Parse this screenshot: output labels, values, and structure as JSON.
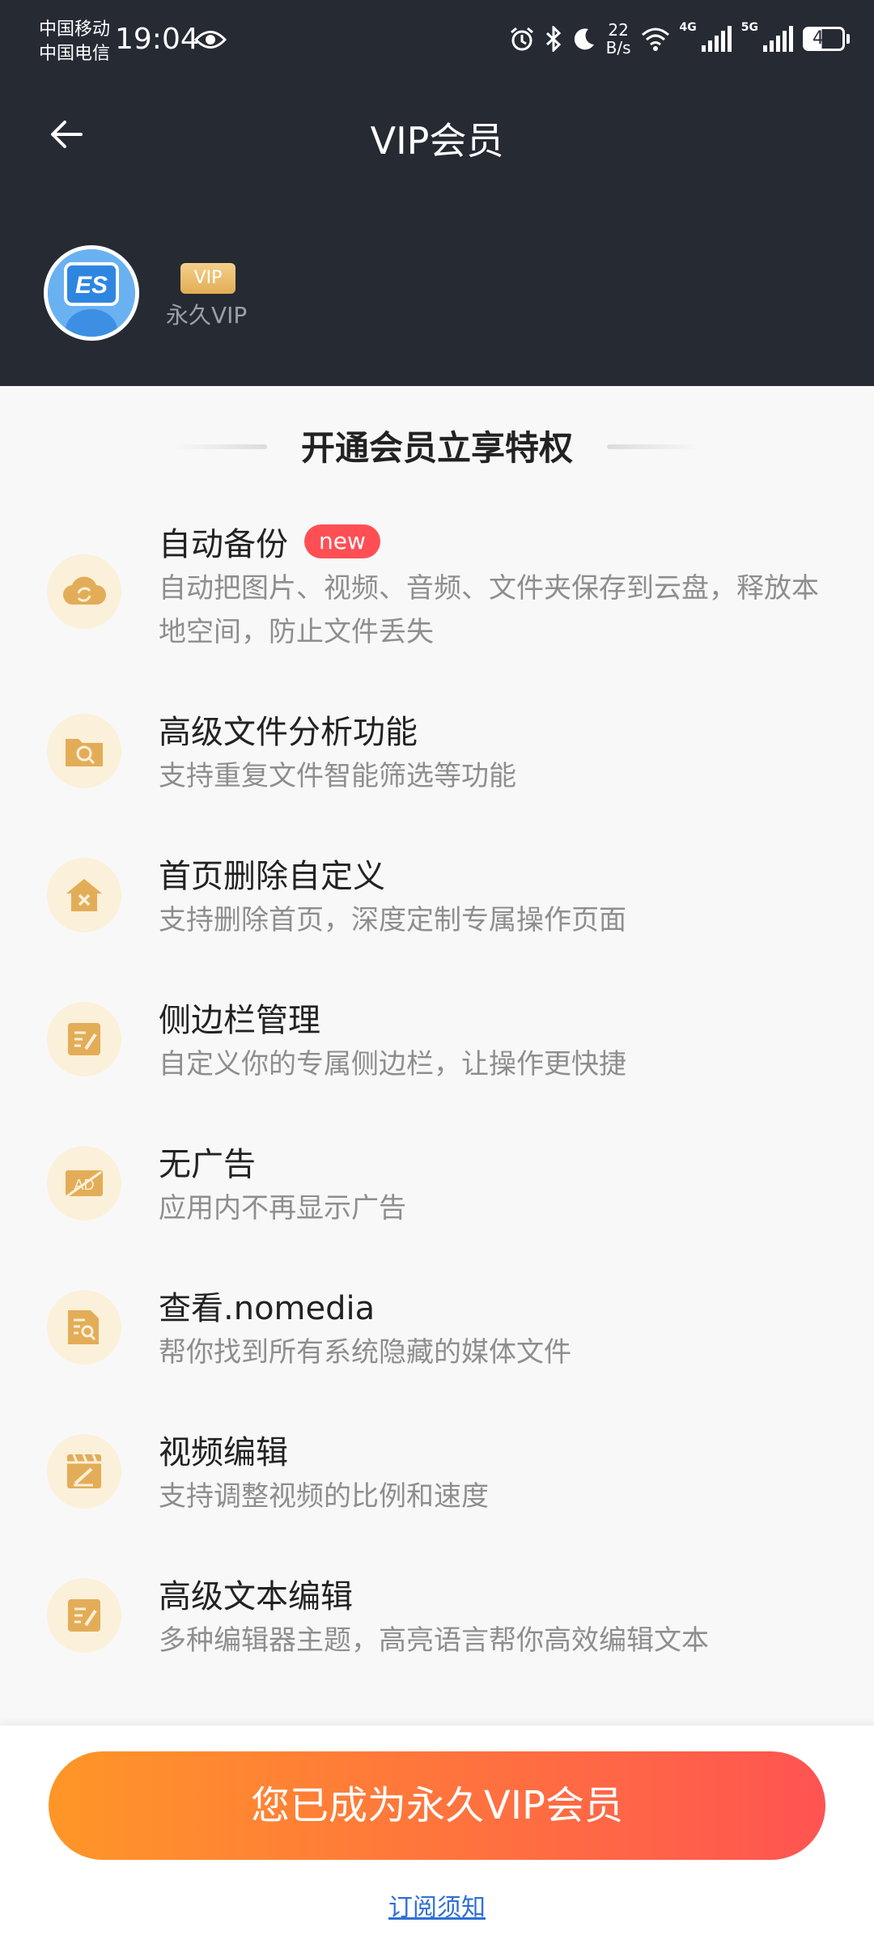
{
  "status_bar": {
    "carrier_1": "中国移动",
    "carrier_2": "中国电信",
    "time": "19:04",
    "net_speed_value": "22",
    "net_speed_unit": "B/s",
    "sig1_tag": "4G",
    "sig2_tag": "5G",
    "battery": "45"
  },
  "header": {
    "title": "VIP会员",
    "vip_badge": "VIP",
    "vip_status": "永久VIP"
  },
  "section_title": "开通会员立享特权",
  "features": [
    {
      "title": "自动备份",
      "badge": "new",
      "desc": "自动把图片、视频、音频、文件夹保存到云盘，释放本地空间，防止文件丢失",
      "icon": "cloud-sync-icon"
    },
    {
      "title": "高级文件分析功能",
      "desc": "支持重复文件智能筛选等功能",
      "icon": "folder-search-icon"
    },
    {
      "title": "首页删除自定义",
      "desc": "支持删除首页，深度定制专属操作页面",
      "icon": "home-delete-icon"
    },
    {
      "title": "侧边栏管理",
      "desc": "自定义你的专属侧边栏，让操作更快捷",
      "icon": "edit-list-icon"
    },
    {
      "title": "无广告",
      "desc": "应用内不再显示广告",
      "icon": "no-ad-icon"
    },
    {
      "title": "查看.nomedia",
      "desc": "帮你找到所有系统隐藏的媒体文件",
      "icon": "file-search-icon"
    },
    {
      "title": "视频编辑",
      "desc": "支持调整视频的比例和速度",
      "icon": "video-edit-icon"
    },
    {
      "title": "高级文本编辑",
      "desc": "多种编辑器主题，高亮语言帮你高效编辑文本",
      "icon": "text-edit-icon"
    }
  ],
  "cta_label": "您已成为永久VIP会员",
  "subscription_notice": "订阅须知",
  "colors": {
    "header_bg": "#262a33",
    "accent_start": "#ff9627",
    "accent_end": "#ff5452",
    "icon_bg": "#fbf0d9",
    "icon_fg": "#e3ad58",
    "badge_red": "#ff4f55"
  }
}
